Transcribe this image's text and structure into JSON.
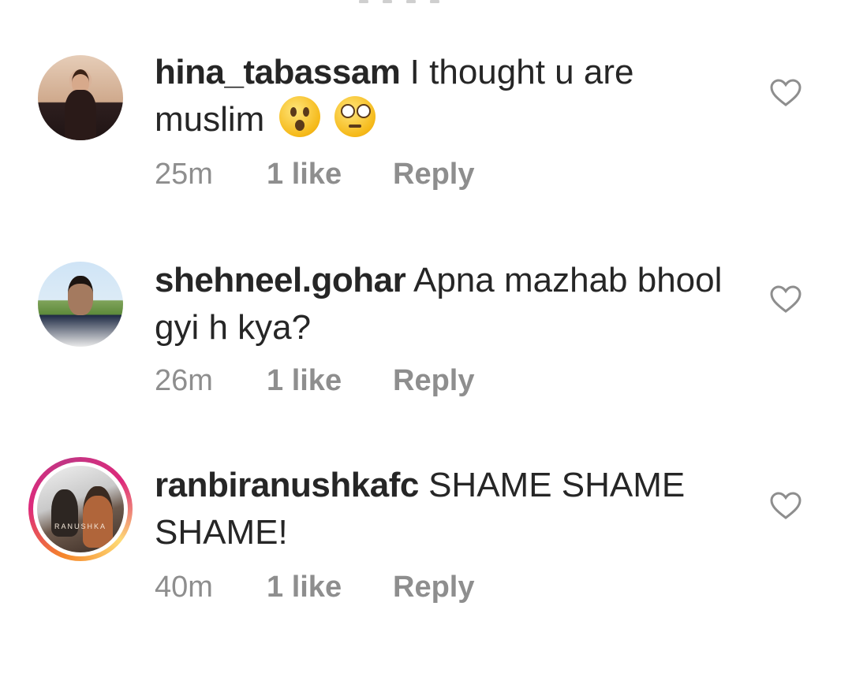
{
  "comments": [
    {
      "username": "hina_tabassam",
      "text": "I thought u are muslim",
      "emojis": [
        "astonished-face",
        "face-with-rolling-eyes"
      ],
      "time": "25m",
      "likes": "1 like",
      "reply": "Reply",
      "has_story_ring": false
    },
    {
      "username": "shehneel.gohar",
      "text": "Apna mazhab bhool gyi h kya?",
      "emojis": [],
      "time": "26m",
      "likes": "1 like",
      "reply": "Reply",
      "has_story_ring": false
    },
    {
      "username": "ranbiranushkafc",
      "text": "SHAME SHAME SHAME!",
      "emojis": [],
      "time": "40m",
      "likes": "1 like",
      "reply": "Reply",
      "has_story_ring": true,
      "avatar_watermark": "RANUSHKA"
    }
  ],
  "colors": {
    "text": "#262626",
    "meta": "#8e8e8e",
    "heart_outline": "#8e8e8e",
    "story_ring": [
      "#feda75",
      "#f58529",
      "#dd2a7b",
      "#c13584"
    ]
  },
  "icons": {
    "like": "heart-outline-icon"
  }
}
